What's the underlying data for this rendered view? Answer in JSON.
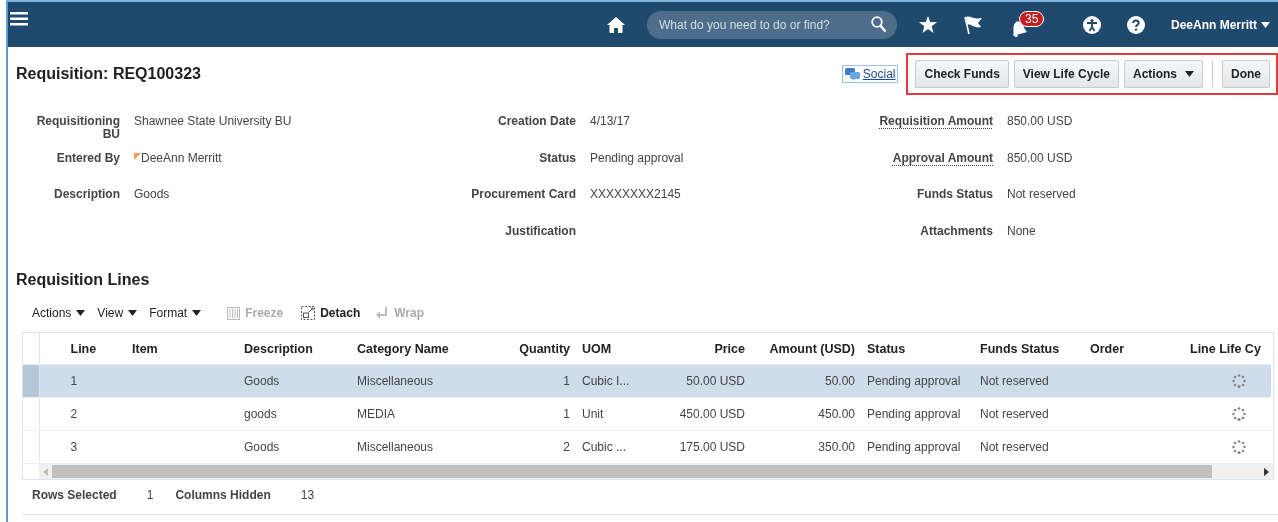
{
  "header": {
    "search": {
      "placeholder": "What do you need to do or find?"
    },
    "notifications": {
      "count": "35"
    },
    "user": "DeeAnn Merritt"
  },
  "page": {
    "title": "Requisition: REQ100323",
    "social": "Social",
    "actions_highlighted": true,
    "buttons": [
      {
        "label": "Check Funds",
        "kind": "button"
      },
      {
        "label": "View Life Cycle",
        "kind": "button"
      },
      {
        "label": "Actions",
        "kind": "menu"
      },
      {
        "label": "Done",
        "kind": "primary"
      }
    ]
  },
  "details": [
    [
      {
        "label": "Requisitioning BU",
        "value": "Shawnee State University BU"
      },
      {
        "label": "Entered By",
        "value": "DeeAnn Merritt",
        "flag": true
      },
      {
        "label": "Description",
        "value": "Goods"
      }
    ],
    [
      {
        "label": "Creation Date",
        "value": "4/13/17"
      },
      {
        "label": "Status",
        "value": "Pending approval"
      },
      {
        "label": "Procurement Card",
        "value": "XXXXXXXX2145"
      },
      {
        "label": "Justification"
      }
    ],
    [
      {
        "label": "Requisition Amount",
        "value": "850.00 USD",
        "underlined": true
      },
      {
        "label": "Approval Amount",
        "value": "850.00 USD",
        "underlined": true
      },
      {
        "label": "Funds Status",
        "value": "Not reserved"
      },
      {
        "label": "Attachments",
        "value": "None"
      }
    ]
  ],
  "lines": {
    "title": "Requisition Lines",
    "toolbar": [
      {
        "label": "Actions",
        "kind": "menu",
        "disabled": false
      },
      {
        "label": "View",
        "kind": "menu",
        "disabled": false
      },
      {
        "label": "Format",
        "kind": "menu",
        "disabled": false
      },
      {
        "label": "Freeze",
        "kind": "freeze",
        "disabled": true
      },
      {
        "label": "Detach",
        "kind": "detach",
        "disabled": false
      },
      {
        "label": "Wrap",
        "kind": "wrap",
        "disabled": true
      }
    ],
    "columns": [
      {
        "label": "Line",
        "kind": "text"
      },
      {
        "label": "Item",
        "kind": "text"
      },
      {
        "label": "Description",
        "kind": "text"
      },
      {
        "label": "Category Name",
        "kind": "text"
      },
      {
        "label": "Quantity",
        "kind": "number"
      },
      {
        "label": "UOM",
        "kind": "text"
      },
      {
        "label": "Price",
        "kind": "number"
      },
      {
        "label": "Amount (USD)",
        "kind": "number"
      },
      {
        "label": "Status",
        "kind": "text"
      },
      {
        "label": "Funds Status",
        "kind": "text"
      },
      {
        "label": "Order",
        "kind": "text"
      },
      {
        "label": "Line Life Cy",
        "kind": "icon"
      }
    ],
    "rows": [
      {
        "selected": true,
        "cells": [
          "1",
          "",
          "Goods",
          "Miscellaneous",
          "1",
          "Cubic I...",
          "50.00 USD",
          "50.00",
          "Pending approval",
          "Not reserved",
          "",
          ""
        ]
      },
      {
        "selected": false,
        "cells": [
          "2",
          "",
          "goods",
          "MEDIA",
          "1",
          "Unit",
          "450.00 USD",
          "450.00",
          "Pending approval",
          "Not reserved",
          "",
          ""
        ]
      },
      {
        "selected": false,
        "cells": [
          "3",
          "",
          "Goods",
          "Miscellaneous",
          "2",
          "Cubic ...",
          "175.00 USD",
          "350.00",
          "Pending approval",
          "Not reserved",
          "",
          ""
        ]
      }
    ],
    "footer": [
      {
        "label": "Rows Selected",
        "value": "1"
      },
      {
        "label": "Columns Hidden",
        "value": "13"
      }
    ]
  }
}
